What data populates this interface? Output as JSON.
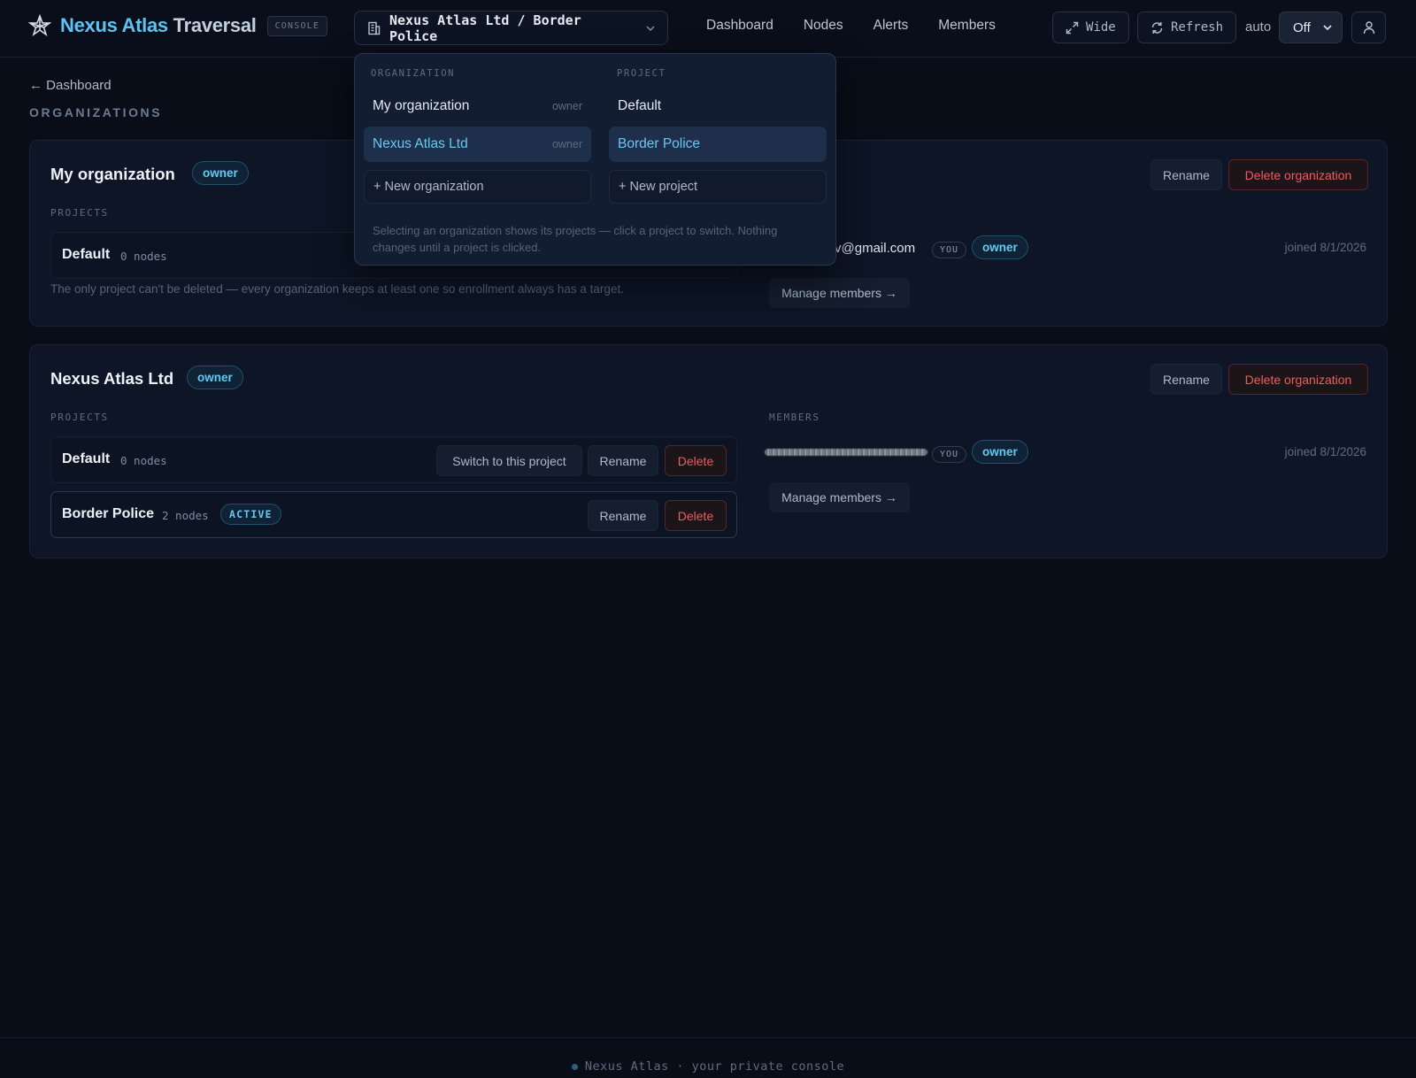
{
  "header": {
    "brand_part1": "Nexus Atlas",
    "brand_part2": "Traversal",
    "badge": "CONSOLE",
    "scope_label": "Nexus Atlas Ltd / Border Police",
    "nav": [
      "Dashboard",
      "Nodes",
      "Alerts",
      "Members"
    ],
    "wide_label": "Wide",
    "refresh_label": "Refresh",
    "auto_label": "auto",
    "auto_value": "Off"
  },
  "page": {
    "back_label": "← Dashboard",
    "title": "ORGANIZATIONS",
    "projects_label": "PROJECTS",
    "members_label": "MEMBERS"
  },
  "orgs": [
    {
      "name": "My organization",
      "role": "owner",
      "rename_label": "Rename",
      "delete_label": "Delete organization",
      "projects": [
        {
          "name": "Default",
          "nodes": "0 nodes"
        }
      ],
      "note": "The only project can't be deleted — every organization keeps at least one so enrollment always has a target.",
      "member": {
        "email": "v@gmail.com",
        "you": "YOU",
        "role": "owner",
        "joined": "joined 8/1/2026"
      },
      "manage_label": "Manage members →"
    },
    {
      "name": "Nexus Atlas Ltd",
      "role": "owner",
      "rename_label": "Rename",
      "delete_label": "Delete organization",
      "projects": [
        {
          "name": "Default",
          "nodes": "0 nodes",
          "switch_label": "Switch to this project",
          "rename_label": "Rename",
          "delete_label": "Delete"
        },
        {
          "name": "Border Police",
          "nodes": "2 nodes",
          "badge": "ACTIVE",
          "rename_label": "Rename",
          "delete_label": "Delete"
        }
      ],
      "member": {
        "you": "YOU",
        "role": "owner",
        "joined": "joined 8/1/2026"
      },
      "manage_label": "Manage members →"
    }
  ],
  "dropdown": {
    "org_label": "ORGANIZATION",
    "project_label": "PROJECT",
    "orgs": [
      {
        "name": "My organization",
        "role": "owner"
      },
      {
        "name": "Nexus Atlas Ltd",
        "role": "owner"
      }
    ],
    "projects": [
      "Default",
      "Border Police"
    ],
    "new_org": "+ New organization",
    "new_project": "+ New project",
    "help": "Selecting an organization shows its projects — click a project to switch. Nothing changes until a project is clicked."
  },
  "footer": {
    "text": "Nexus Atlas · your private console"
  },
  "colors": {
    "accent": "#5ec3f0",
    "danger": "#ef5d5d",
    "background": "#080d18"
  }
}
